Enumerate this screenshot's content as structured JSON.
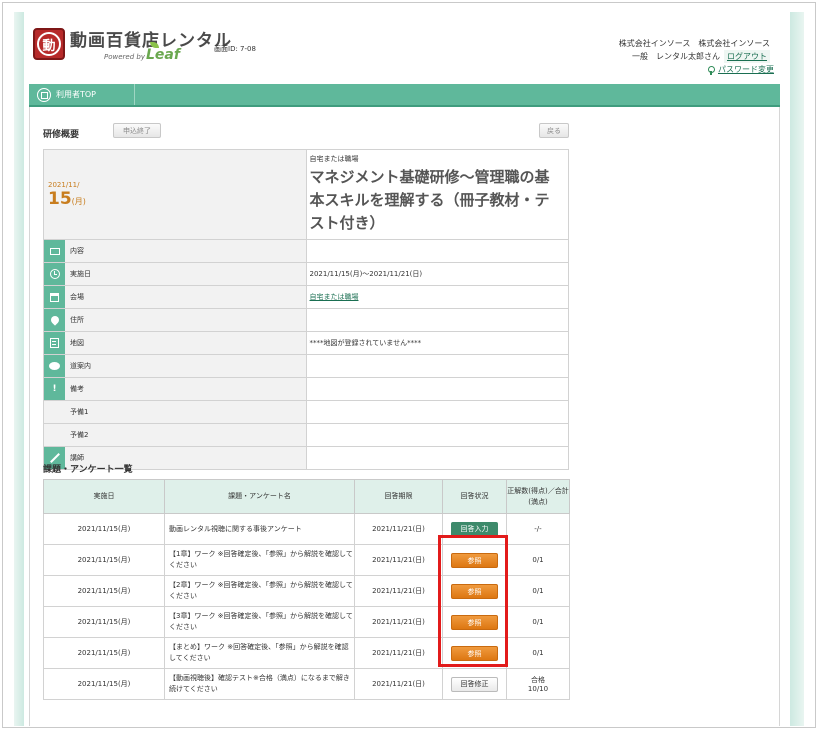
{
  "header": {
    "logo_char": "動",
    "title": "動画百貨店レンタル",
    "powered_by": "Powered by",
    "leaf": "Leaf",
    "screen_id": "画面ID: 7-08",
    "company": "株式会社インソース　株式会社インソース",
    "user": "一般　レンタル太郎さん",
    "logout": "ログアウト",
    "password_change": "パスワード変更"
  },
  "nav": {
    "user_top": "利用者TOP"
  },
  "overview": {
    "title": "研修概要",
    "apply_end": "申込終了",
    "back": "戻る",
    "date_ym": "2021/11/",
    "date_day": "15",
    "date_dow": "(月)",
    "venue_type": "自宅または職場",
    "course_title": "マネジメント基礎研修～管理職の基本スキルを理解する（冊子教材・テスト付き）",
    "rows": [
      {
        "label": "内容",
        "value": ""
      },
      {
        "label": "実施日",
        "value": "2021/11/15(月)～2021/11/21(日)"
      },
      {
        "label": "会場",
        "value": "自宅または職場"
      },
      {
        "label": "住所",
        "value": ""
      },
      {
        "label": "地図",
        "value": "****地図が登録されていません****"
      },
      {
        "label": "道案内",
        "value": ""
      },
      {
        "label": "備考",
        "value": ""
      },
      {
        "label": "予備1",
        "value": ""
      },
      {
        "label": "予備2",
        "value": ""
      },
      {
        "label": "講師",
        "value": ""
      }
    ]
  },
  "assignments": {
    "title": "課題・アンケート一覧",
    "headers": [
      "実施日",
      "課題・アンケート名",
      "回答期限",
      "回答状況",
      "正解数(得点)／合計(満点)"
    ],
    "rows": [
      {
        "date": "2021/11/15(月)",
        "name": "動画レンタル視聴に関する事後アンケート",
        "deadline": "2021/11/21(日)",
        "status": "回答入力",
        "score": "-/-"
      },
      {
        "date": "2021/11/15(月)",
        "name": "【1章】ワーク ※回答確定後、「参照」から解説を確認してください",
        "deadline": "2021/11/21(日)",
        "status": "参照",
        "score": "0/1"
      },
      {
        "date": "2021/11/15(月)",
        "name": "【2章】ワーク ※回答確定後、「参照」から解説を確認してください",
        "deadline": "2021/11/21(日)",
        "status": "参照",
        "score": "0/1"
      },
      {
        "date": "2021/11/15(月)",
        "name": "【3章】ワーク ※回答確定後、「参照」から解説を確認してください",
        "deadline": "2021/11/21(日)",
        "status": "参照",
        "score": "0/1"
      },
      {
        "date": "2021/11/15(月)",
        "name": "【まとめ】ワーク ※回答確定後、「参照」から解説を確認してください",
        "deadline": "2021/11/21(日)",
        "status": "参照",
        "score": "0/1"
      },
      {
        "date": "2021/11/15(月)",
        "name": "【動画視聴後】確認テスト※合格（満点）になるまで解き続けてください",
        "deadline": "2021/11/21(日)",
        "status": "回答修正",
        "score_line1": "合格",
        "score_line2": "10/10"
      }
    ]
  }
}
